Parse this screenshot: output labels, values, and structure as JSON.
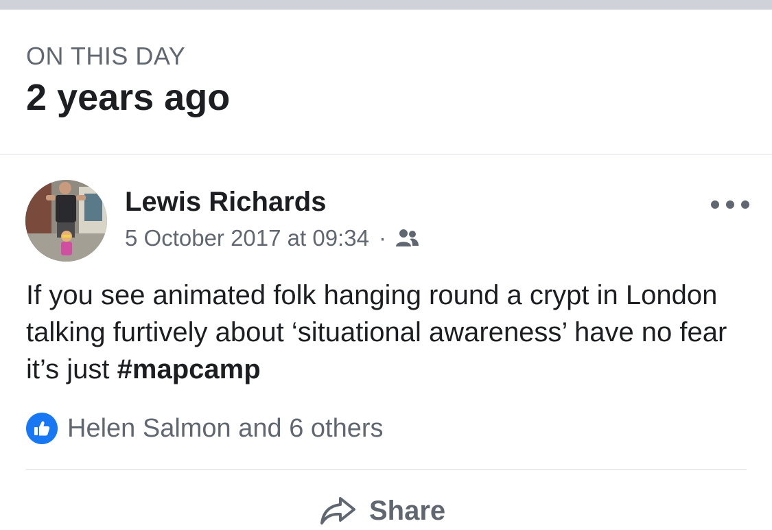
{
  "memory": {
    "eyebrow": "ON THIS DAY",
    "headline": "2 years ago"
  },
  "post": {
    "author": "Lewis Richards",
    "timestamp": "5 October 2017 at 09:34",
    "separator": "·",
    "audience_icon": "friends-icon",
    "text_before_hashtag": "If you see animated folk hanging round a crypt in London talking furtively about ‘situational awareness’ have no fear it’s just ",
    "hashtag": "#mapcamp",
    "more_icon": "more-options-icon"
  },
  "reactions": {
    "icon": "like-icon",
    "summary": "Helen Salmon and 6 others"
  },
  "actions": {
    "share_label": "Share",
    "share_icon": "share-icon"
  },
  "colors": {
    "accent": "#1877f2",
    "secondary_text": "#606770",
    "primary_text": "#1c1e21",
    "divider": "#dddfe2"
  }
}
